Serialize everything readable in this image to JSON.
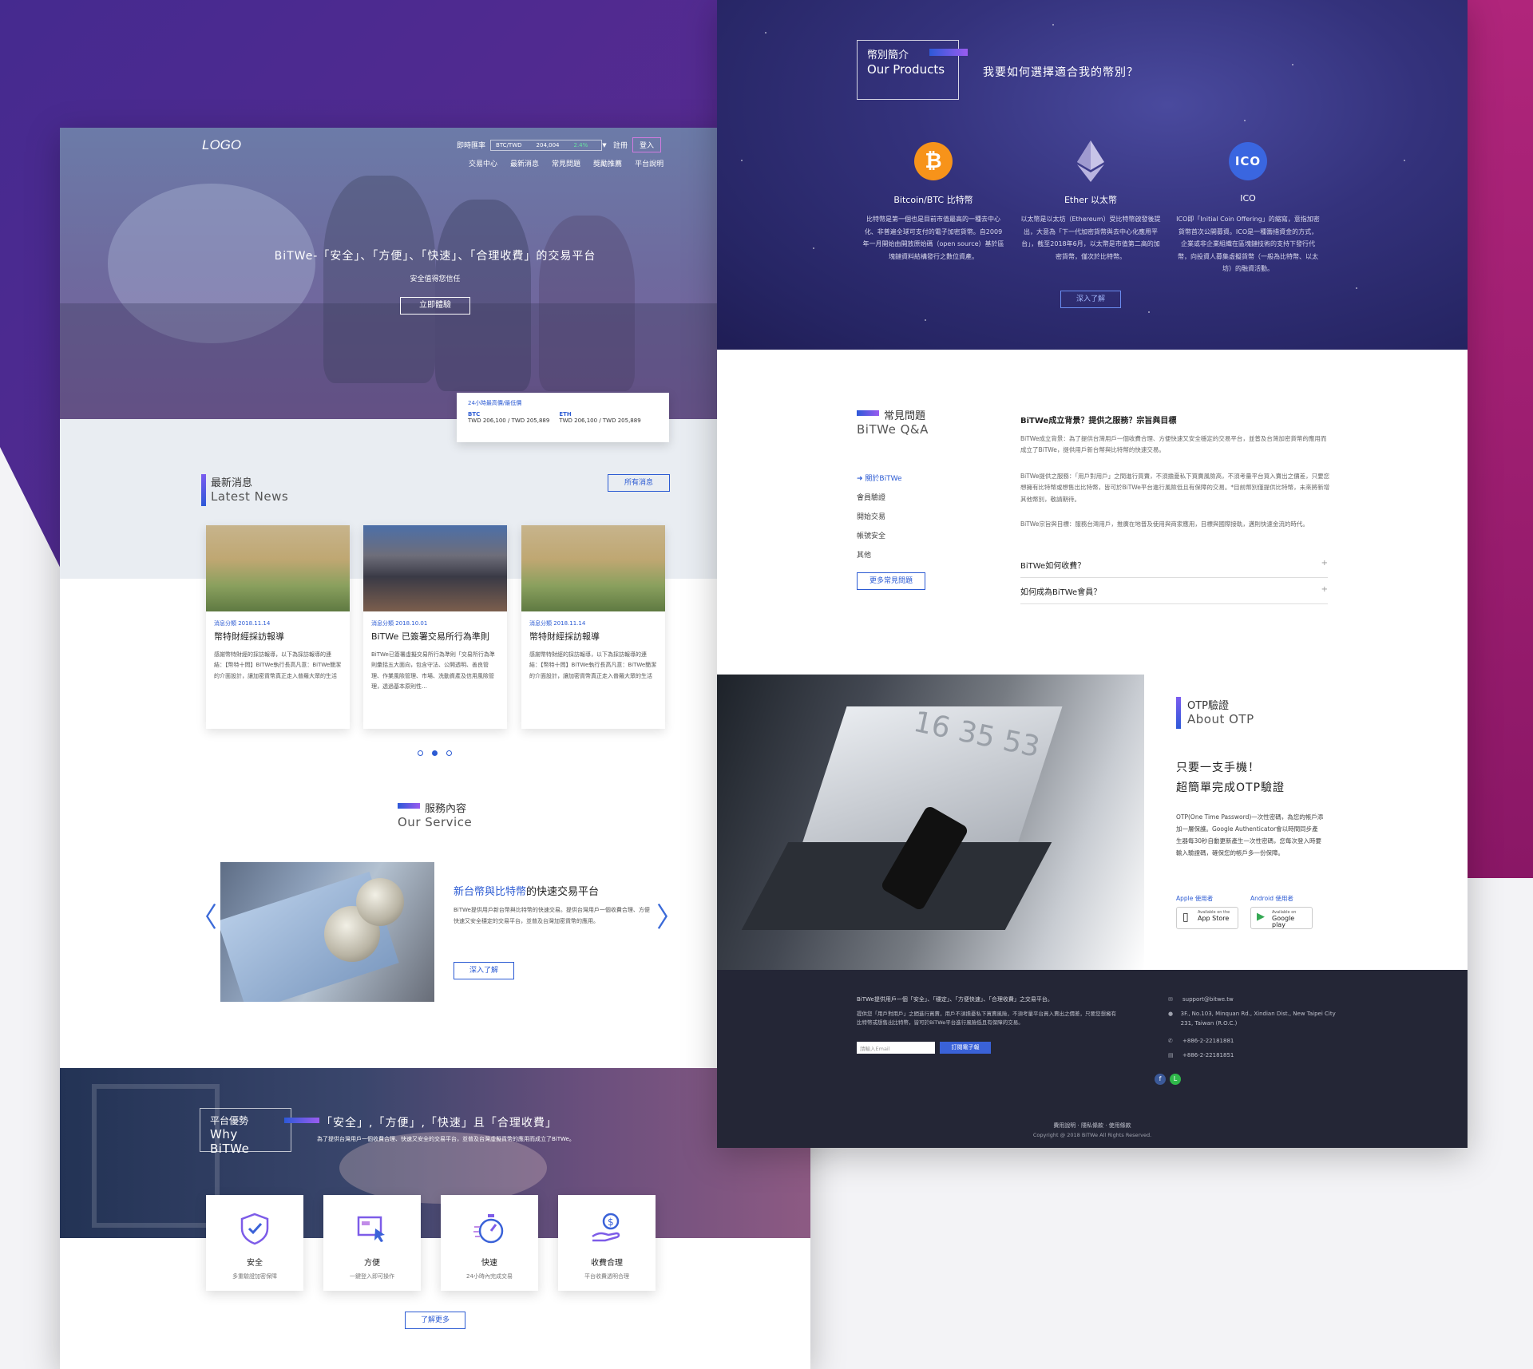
{
  "left": {
    "logo": "LOGO",
    "topbar": {
      "rate_label": "即時匯率",
      "pair": "BTC/TWD",
      "rate_value": "204,004",
      "rate_change": "2.4%",
      "register": "註冊",
      "login": "登入"
    },
    "nav": [
      "交易中心",
      "最新消息",
      "常見問題",
      "獎勵推薦",
      "平台說明"
    ],
    "hero": {
      "title": "BiTWe-「安全」、「方便」、「快速」、「合理收費」的交易平台",
      "subtitle": "安全值得您信任",
      "cta": "立即體驗"
    },
    "price_card": {
      "title": "24小時最高價/最低價",
      "btc_label": "BTC",
      "btc_value": "TWD 206,100 / TWD 205,889",
      "eth_label": "ETH",
      "eth_value": "TWD 206,100 / TWD 205,889"
    },
    "news": {
      "title_zh": "最新消息",
      "title_en": "Latest News",
      "all_button": "所有消息",
      "items": [
        {
          "date": "消息分類 2018.11.14",
          "title": "幣特財經採訪報導",
          "text": "感謝幣特財經的採訪報導，以下為採訪報導的連結：【幣特十問】BiTWe執行長高凡意：BiTWe簡潔的介面設計，讓加密貨幣真正走入普羅大眾的生活"
        },
        {
          "date": "消息分類 2018.10.01",
          "title": "BiTWe 已簽署交易所行為準則",
          "text": "BiTWe已簽署虛擬交易所行為準則「交易所行為準則彙括五大面向，包含守法、公開透明、善良管理、作業風險管理、市場、洗動資產及信用風險管理，透過基本原則性…"
        },
        {
          "date": "消息分類 2018.11.14",
          "title": "幣特財經採訪報導",
          "text": "感謝幣特財經的採訪報導，以下為採訪報導的連結：【幣特十問】BiTWe執行長高凡意：BiTWe簡潔的介面設計，讓加密貨幣真正走入普羅大眾的生活"
        }
      ]
    },
    "service": {
      "title_zh": "服務內容",
      "title_en": "Our Service",
      "heading_highlight": "新台幣與比特幣",
      "heading_rest": "的快速交易平台",
      "text": "BiTWe提供用戶新台幣與比特幣的快速交易。提供台灣用戶一個收費合理、方便快速又安全穩定的交易平台，並普及台灣加密貨幣的應用。",
      "button": "深入了解",
      "prev": "〈",
      "next": "〉"
    },
    "why": {
      "title_zh": "平台優勢",
      "title_en": "Why BiTWe",
      "heading": "「安全」,「方便」,「快速」且「合理收費」",
      "sub": "為了提供台灣用戶一個收費合理、快速又安全的交易平台，並普及台灣虛擬貨幣的應用而成立了BiTWe。",
      "cards": [
        {
          "name": "安全",
          "desc": "多重驗證加密保障",
          "icon": "shield-icon"
        },
        {
          "name": "方便",
          "desc": "一鍵登入即可操作",
          "icon": "click-icon"
        },
        {
          "name": "快速",
          "desc": "24小時內完成交易",
          "icon": "stopwatch-icon"
        },
        {
          "name": "收費合理",
          "desc": "平台收費透明合理",
          "icon": "dollar-hand-icon"
        }
      ],
      "more_button": "了解更多"
    }
  },
  "right": {
    "products": {
      "title_zh": "幣別簡介",
      "title_en": "Our Products",
      "question": "我要如何選擇適合我的幣別？",
      "items": [
        {
          "icon": "bitcoin-icon",
          "name": "Bitcoin/BTC 比特幣",
          "desc": "比特幣是第一個也是目前市值最高的一種去中心化、非普遍全球可支付的電子加密貨幣。自2009年一月開始由開放原始碼（open source）基於區塊鏈資料結構發行之數位資產。"
        },
        {
          "icon": "ethereum-icon",
          "name": "Ether 以太幣",
          "desc": "以太幣是以太坊（Ethereum）受比特幣啟發後提出，大意為「下一代加密貨幣與去中心化應用平台」，截至2018年6月，以太幣是市值第二高的加密貨幣，僅次於比特幣。"
        },
        {
          "icon": "ico-icon",
          "name": "ICO",
          "desc": "ICO即「Initial Coin Offering」的縮寫，意指加密貨幣首次公開募資。ICO是一種籌措資金的方式，企業或非企業組織在區塊鏈技術的支持下發行代幣，向投資人募集虛擬貨幣（一般為比特幣、以太坊）的融資活動。"
        }
      ],
      "button": "深入了解"
    },
    "faq": {
      "title_zh": "常見問題",
      "title_en": "BiTWe Q&A",
      "nav": [
        "關於BiTWe",
        "會員驗證",
        "開始交易",
        "帳號安全",
        "其他"
      ],
      "more_button": "更多常見問題",
      "open_question": "BiTWe成立背景？提供之服務？宗旨與目標",
      "paragraphs": [
        "BiTWe成立背景：為了提供台灣用戶一個收費合理、方便快速又安全穩定的交易平台，並普及台灣加密貨幣的應用而成立了BiTWe，提供用戶新台幣與比特幣的快速交易。",
        "BiTWe提供之服務：「用戶對用戶」之間進行買賣，不須擔憂私下買賣風險高，不須考量平台買入賣出之價差，只要您想擁有比特幣或想售出比特幣，皆可於BiTWe平台進行風險低且有保障的交易。*目前幣別僅提供比特幣，未來將新增其他幣別，敬請期待。",
        "BiTWe宗旨與目標：服務台灣用戶，推廣在地普及使用與商家應用，目標與國際接軌，邁則快速金流的時代。"
      ],
      "questions": [
        "BiTWe如何收費？",
        "如何成為BiTWe會員？"
      ],
      "plus": "+"
    },
    "otp": {
      "title_zh": "OTP驗證",
      "title_en": "About OTP",
      "heading1": "只要一支手機！",
      "heading2": "超簡單完成OTP驗證",
      "text": "OTP(One Time Password)一次性密碼，為您的帳戶添加一層保護。Google Authenticator會以時間同步產生器每30秒自動更新產生一次性密碼，您每次登入時要輸入驗證碼，確保您的帳戶多一份保障。",
      "screen_time": "16 35 53",
      "apple_label": "Apple 使用者",
      "android_label": "Android 使用者",
      "appstore_small": "Available on the",
      "appstore": "App Store",
      "gplay_small": "Available on",
      "gplay": "Google play"
    },
    "footer": {
      "line1": "BiTWe提供用戶一個「安全」、「穩定」、「方便快速」、「合理收費」之交易平台。",
      "line2": "提供您「用戶對用戶」之間進行買賣，用戶不須擔憂私下買賣風險，不須考量平台買入賣出之價差，只要您想擁有比特幣或想售出比特幣，皆可於BiTWe平台進行風險低且有保障的交易。",
      "email_placeholder": "請輸入Email",
      "subscribe": "訂閱電子報",
      "email": "support@bitwe.tw",
      "address": "3F., No.103, Minquan Rd., Xindian Dist., New Taipei City 231, Taiwan (R.O.C.)",
      "phone": "+886-2-22181881",
      "fax": "+886-2-22181851",
      "links": "費用說明 · 隱私條款 · 使用條款",
      "copyright": "Copyright @ 2018 BiTWe All Rights Reserved."
    }
  }
}
